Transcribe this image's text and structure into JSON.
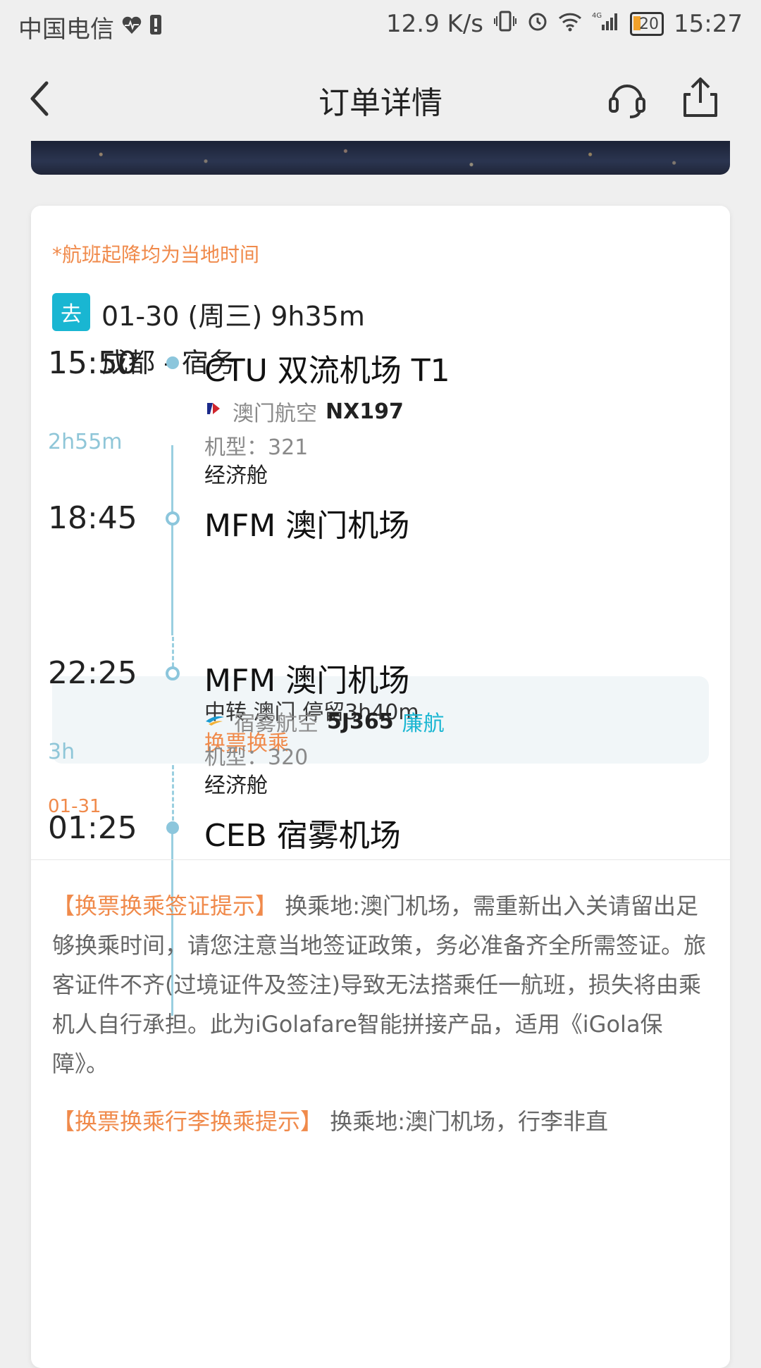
{
  "status_bar": {
    "carrier": "中国电信",
    "speed": "12.9 K/s",
    "network": "4G",
    "battery": "20",
    "time": "15:27"
  },
  "header": {
    "title": "订单详情"
  },
  "card": {
    "note": "*航班起降均为当地时间",
    "badge": "去",
    "date_line": "01-30 (周三) 9h35m",
    "route": "成都 - 宿务",
    "segments": [
      {
        "dep_time": "15:50",
        "dep_airport": "CTU 双流机场 T1",
        "airline": "澳门航空",
        "flight_no": "NX197",
        "duration": "2h55m",
        "aircraft": "机型：321",
        "cabin": "经济舱",
        "arr_time": "18:45",
        "arr_airport": "MFM 澳门机场"
      },
      {
        "dep_time": "22:25",
        "dep_airport": "MFM 澳门机场",
        "airline": "宿雾航空",
        "flight_no": "5J365",
        "lcc_label": "廉航",
        "duration": "3h",
        "aircraft": "机型：320",
        "cabin": "经济舱",
        "arr_date": "01-31",
        "arr_time": "01:25",
        "arr_airport": "CEB 宿雾机场"
      }
    ],
    "transfer": {
      "line1": "中转 澳门 停留3h40m",
      "line2": "换票换乘"
    },
    "tips": [
      {
        "title": "【换票换乘签证提示】",
        "text": " 换乘地:澳门机场，需重新出入关请留出足够换乘时间，请您注意当地签证政策，务必准备齐全所需签证。旅客证件不齐(过境证件及签注)导致无法搭乘任一航班，损失将由乘机人自行承担。此为iGolafare智能拼接产品，适用《iGola保障》。"
      },
      {
        "title": "【换票换乘行李换乘提示】",
        "text": " 换乘地:澳门机场，行李非直"
      }
    ]
  },
  "colors": {
    "accent_orange": "#f08a4b",
    "accent_teal": "#19b6d2",
    "timeline": "#9acfe0"
  }
}
